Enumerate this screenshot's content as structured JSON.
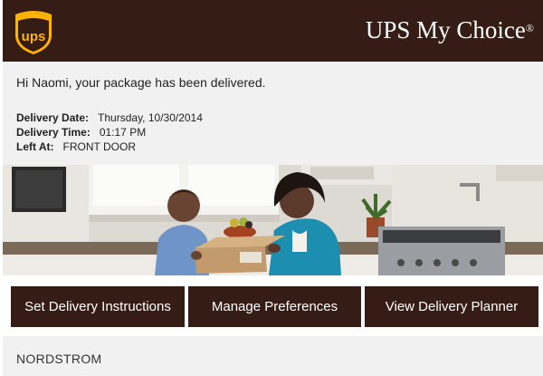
{
  "header": {
    "brand_name": "UPS My Choice",
    "registered_mark": "®",
    "logo_text": "ups",
    "logo_icon": "ups-shield-icon"
  },
  "info": {
    "greeting": "Hi Naomi, your package has been delivered.",
    "delivery_date_label": "Delivery Date:",
    "delivery_date_value": "Thursday, 10/30/2014",
    "delivery_time_label": "Delivery Time:",
    "delivery_time_value": "01:17 PM",
    "left_at_label": "Left At:",
    "left_at_value": "FRONT DOOR"
  },
  "buttons": {
    "set_delivery_instructions": "Set Delivery Instructions",
    "manage_preferences": "Manage Preferences",
    "view_delivery_planner": "View Delivery Planner"
  },
  "footer": {
    "merchant": "NORDSTROM"
  },
  "colors": {
    "brand_brown": "#351c15",
    "brand_gold": "#ffb500",
    "panel_gray": "#f1f1f1"
  }
}
